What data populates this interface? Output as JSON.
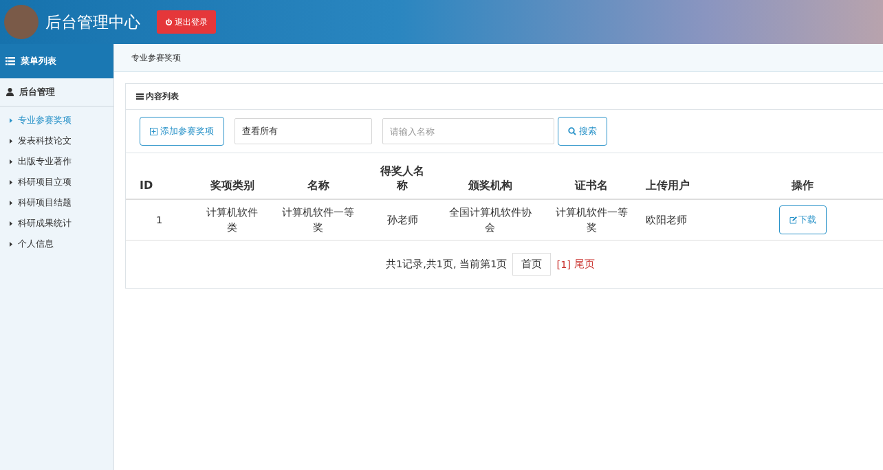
{
  "header": {
    "title": "后台管理中心",
    "logout": "退出登录"
  },
  "sidebar": {
    "title": "菜单列表",
    "section": "后台管理",
    "items": [
      {
        "label": "专业参赛奖项",
        "selected": true
      },
      {
        "label": "发表科技论文",
        "selected": false
      },
      {
        "label": "出版专业著作",
        "selected": false
      },
      {
        "label": "科研项目立项",
        "selected": false
      },
      {
        "label": "科研项目结题",
        "selected": false
      },
      {
        "label": "科研成果统计",
        "selected": false
      },
      {
        "label": "个人信息",
        "selected": false
      }
    ]
  },
  "breadcrumb": "专业参赛奖项",
  "panel": {
    "title": "内容列表",
    "add_button": "添加参赛奖项",
    "filter": {
      "value": "查看所有"
    },
    "search": {
      "placeholder": "请输入名称"
    },
    "search_button": "搜索"
  },
  "table": {
    "columns": [
      "ID",
      "奖项类别",
      "名称",
      "得奖人名称",
      "颁奖机构",
      "证书名",
      "上传用户",
      "操作"
    ],
    "rows": [
      {
        "cells": [
          "1",
          "计算机软件类",
          "计算机软件一等奖",
          "孙老师",
          "全国计算机软件协会",
          "计算机软件一等奖",
          "欧阳老师"
        ],
        "action": "下载"
      }
    ]
  },
  "pagination": {
    "summary": "共1记录,共1页, 当前第1页",
    "first": "首页",
    "current": "[1]",
    "last": "尾页"
  }
}
